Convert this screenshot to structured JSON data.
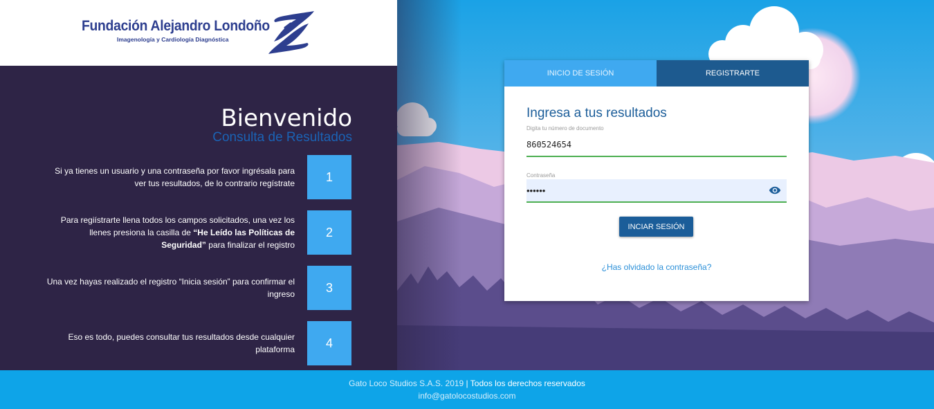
{
  "brand": {
    "name": "Fundación Alejandro Londoño",
    "tagline": "Imagenología y Cardiología Diagnóstica",
    "primary_color": "#2d3e8f",
    "accent_color": "#3fa9f0"
  },
  "welcome": {
    "title": "Bienvenido",
    "subtitle": "Consulta de Resultados"
  },
  "steps": [
    {
      "number": "1",
      "text": "Si ya tienes un usuario y una contraseña por favor ingrésala para ver tus resultados, de lo contrario regístrate"
    },
    {
      "number": "2",
      "text_before": "Para regiístrarte llena todos los campos solicitados, una vez los llenes presiona la casilla de ",
      "text_bold": "“He Leído las Políticas de Seguridad”",
      "text_after": " para finalizar el registro"
    },
    {
      "number": "3",
      "text": "Una vez hayas realizado el registro “Inicia sesión” para confirmar el ingreso"
    },
    {
      "number": "4",
      "text": "Eso es todo, puedes consultar tus resultados desde cualquier plataforma"
    }
  ],
  "login": {
    "tabs": [
      {
        "label": "INICIO DE SESIÓN",
        "active": true
      },
      {
        "label": "REGISTRARTE",
        "active": false
      }
    ],
    "title": "Ingresa a tus resultados",
    "document_label": "Digita tu número de documento",
    "document_value": "860524654",
    "password_label": "Contraseña",
    "password_value": "••••••",
    "submit_label": "INCIAR SESIÓN",
    "forgot_label": "¿Has olvidado la contraseña?",
    "eye_icon": "eye-icon"
  },
  "footer": {
    "company": "Gato Loco Studios S.A.S. 2019",
    "separator": " | ",
    "rights": "Todos los derechos reservados",
    "email": "info@gatolocostudios.com"
  }
}
